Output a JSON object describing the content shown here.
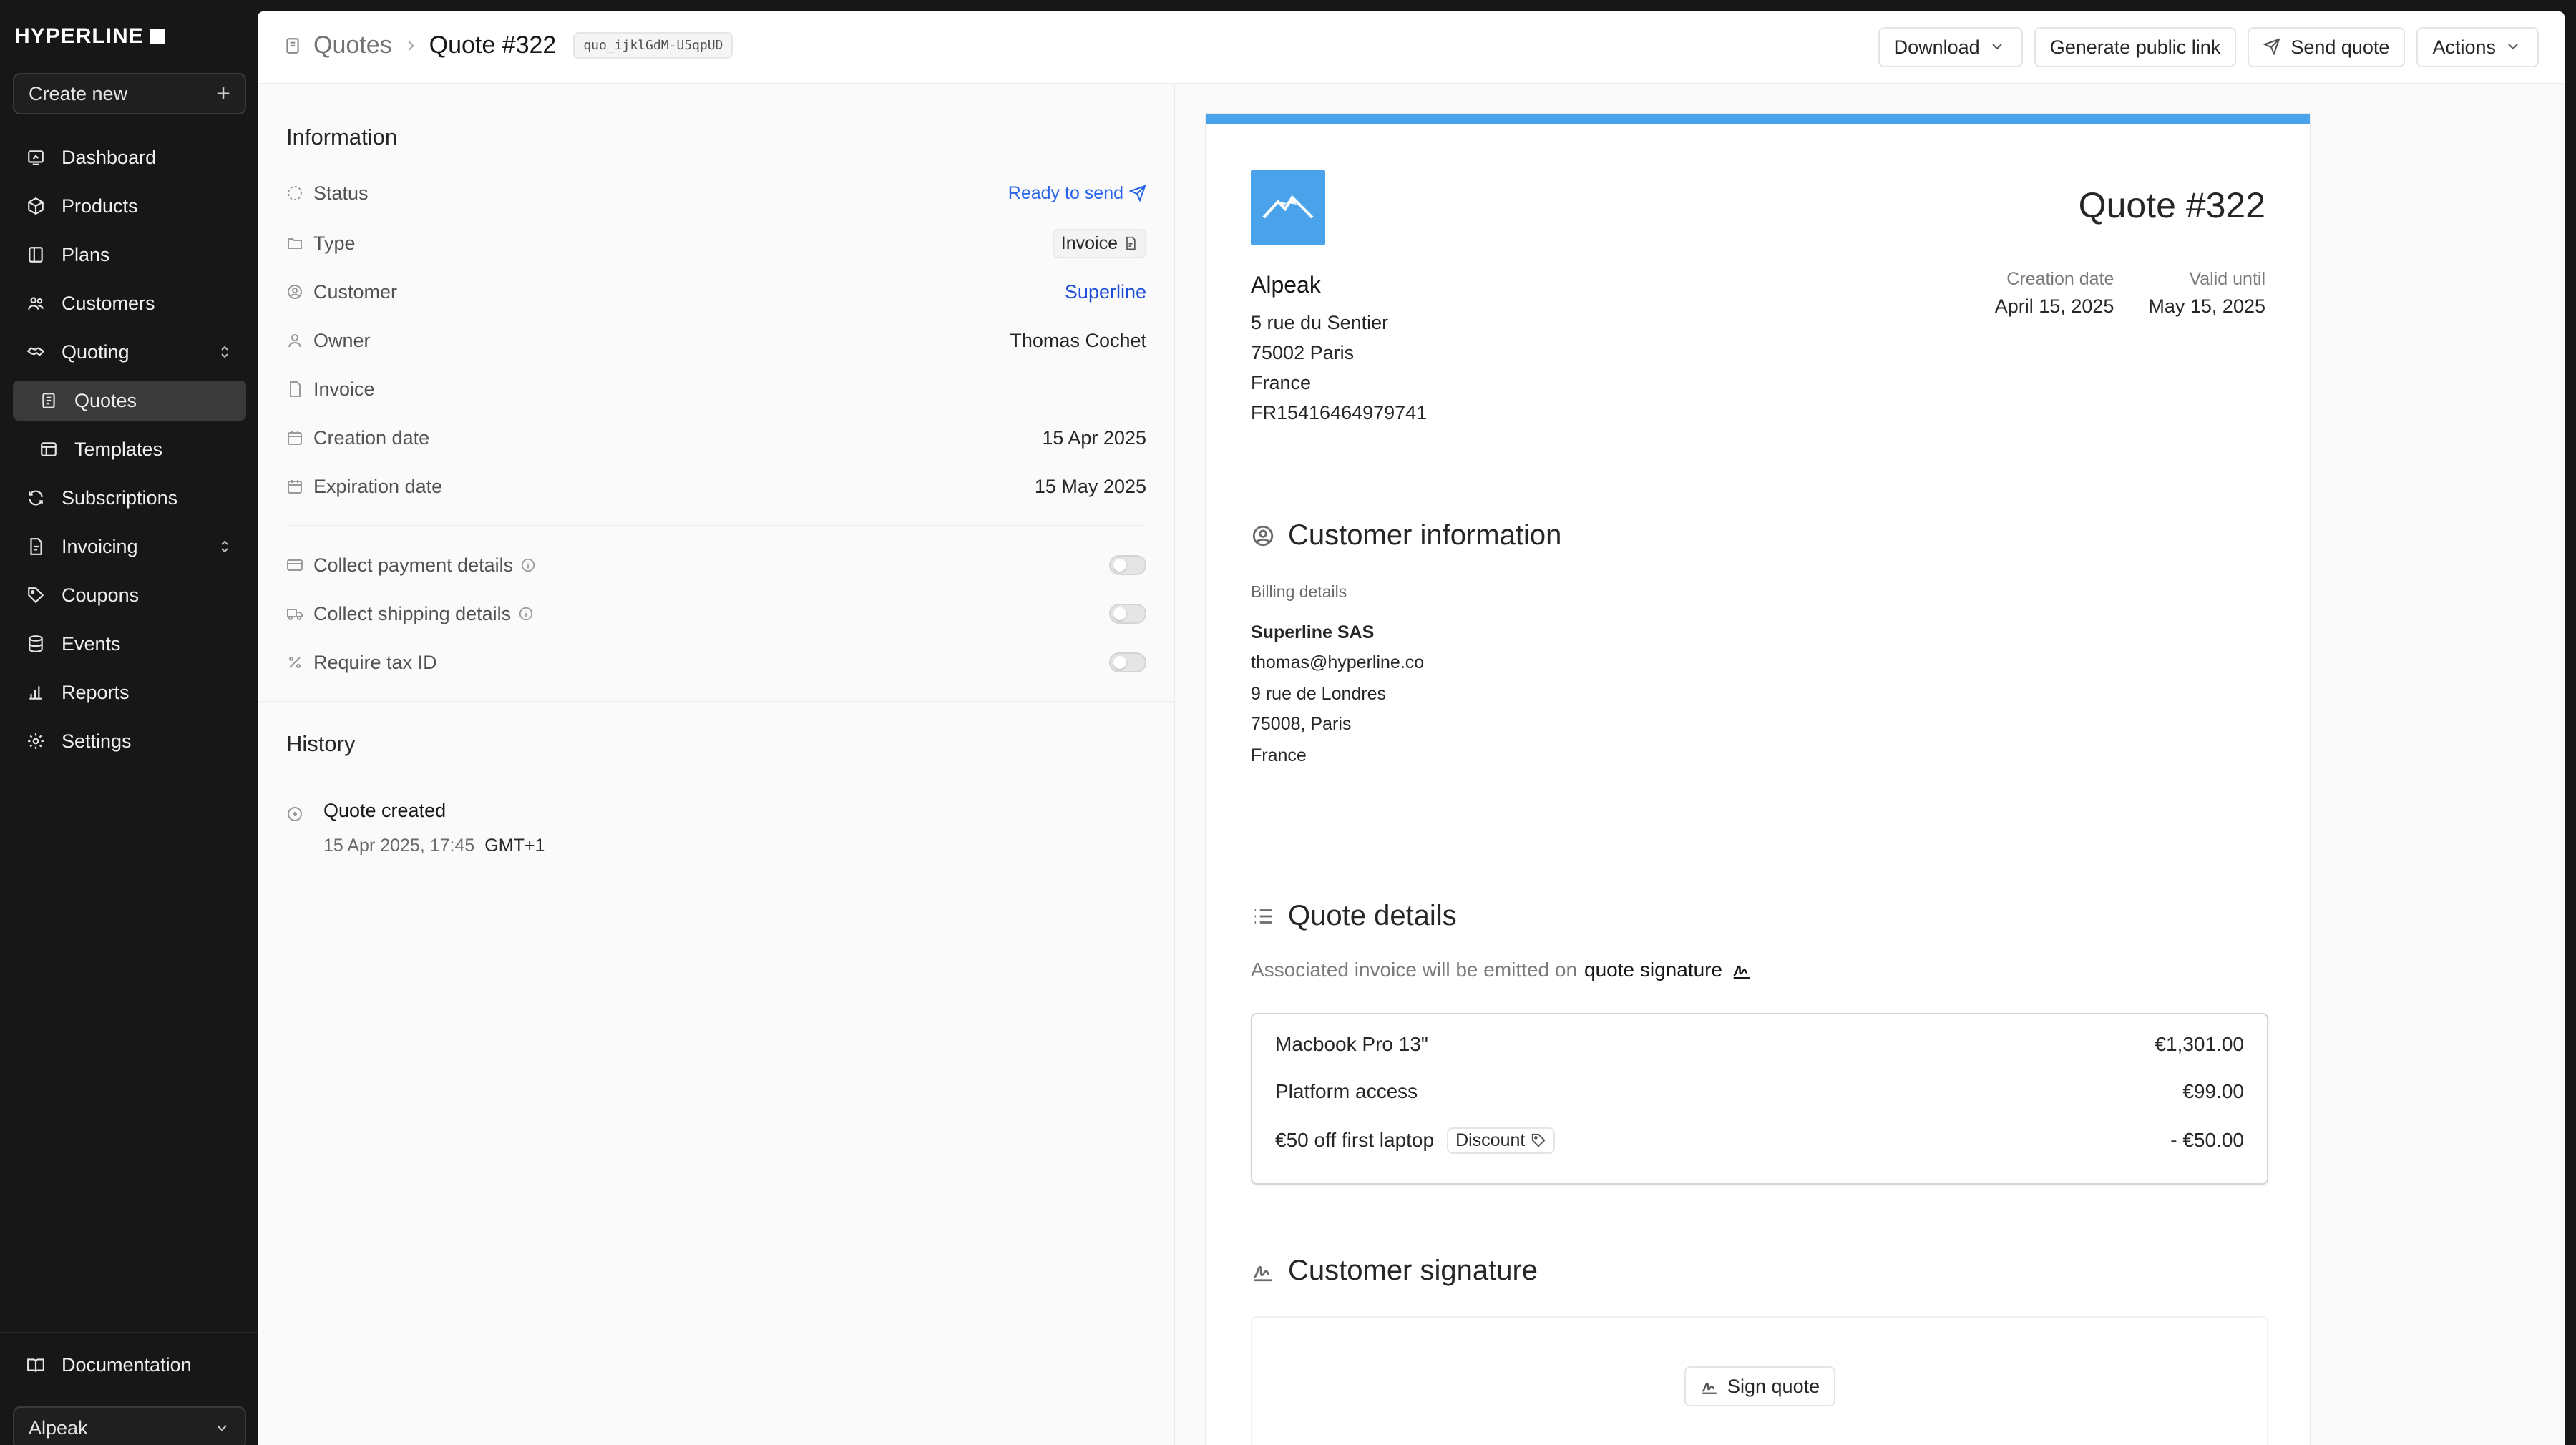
{
  "app": {
    "brand": "HYPERLINE"
  },
  "sidebar": {
    "create_new": "Create new",
    "items": [
      {
        "label": "Dashboard",
        "icon": "dashboard-icon"
      },
      {
        "label": "Products",
        "icon": "box-icon"
      },
      {
        "label": "Plans",
        "icon": "plans-icon"
      },
      {
        "label": "Customers",
        "icon": "users-icon"
      },
      {
        "label": "Quoting",
        "icon": "handshake-icon"
      },
      {
        "label": "Quotes",
        "icon": "quote-icon"
      },
      {
        "label": "Templates",
        "icon": "template-icon"
      },
      {
        "label": "Subscriptions",
        "icon": "refresh-icon"
      },
      {
        "label": "Invoicing",
        "icon": "invoice-icon"
      },
      {
        "label": "Coupons",
        "icon": "tag-icon"
      },
      {
        "label": "Events",
        "icon": "database-icon"
      },
      {
        "label": "Reports",
        "icon": "chart-icon"
      },
      {
        "label": "Settings",
        "icon": "gear-icon"
      }
    ],
    "documentation": "Documentation",
    "workspace": "Alpeak"
  },
  "header": {
    "breadcrumb_root": "Quotes",
    "title": "Quote #322",
    "quote_id": "quo_ijklGdM-U5qpUD",
    "buttons": {
      "download": "Download",
      "public_link": "Generate public link",
      "send": "Send quote",
      "actions": "Actions"
    }
  },
  "information": {
    "title": "Information",
    "status_label": "Status",
    "status_value": "Ready to send",
    "type_label": "Type",
    "type_value": "Invoice",
    "customer_label": "Customer",
    "customer_value": "Superline",
    "owner_label": "Owner",
    "owner_value": "Thomas Cochet",
    "invoice_label": "Invoice",
    "creation_label": "Creation date",
    "creation_value": "15 Apr 2025",
    "expiration_label": "Expiration date",
    "expiration_value": "15 May 2025",
    "collect_payment": "Collect payment details",
    "collect_shipping": "Collect shipping details",
    "require_tax": "Require tax ID"
  },
  "history": {
    "title": "History",
    "event": "Quote created",
    "time": "15 Apr 2025, 17:45",
    "tz": "GMT+1"
  },
  "preview": {
    "accent": "#4aa3ea",
    "title": "Quote #322",
    "company": "Alpeak",
    "address": [
      "5 rue du Sentier",
      "75002 Paris",
      "France",
      "FR15416464979741"
    ],
    "creation_label": "Creation date",
    "creation_value": "April 15, 2025",
    "valid_label": "Valid until",
    "valid_value": "May 15, 2025",
    "customer_info_title": "Customer information",
    "billing_label": "Billing details",
    "billing": [
      "Superline SAS",
      "thomas@hyperline.co",
      "9 rue de Londres",
      "75008, Paris",
      "France"
    ],
    "quote_details_title": "Quote details",
    "emit_prefix": "Associated invoice will be emitted on",
    "emit_strong": "quote signature",
    "lines": [
      {
        "label": "Macbook Pro 13\"",
        "amount": "€1,301.00"
      },
      {
        "label": "Platform access",
        "amount": "€99.00"
      },
      {
        "label": "€50 off first laptop",
        "badge": "Discount",
        "amount": "- €50.00"
      }
    ],
    "signature_title": "Customer signature",
    "sign_button": "Sign quote"
  }
}
